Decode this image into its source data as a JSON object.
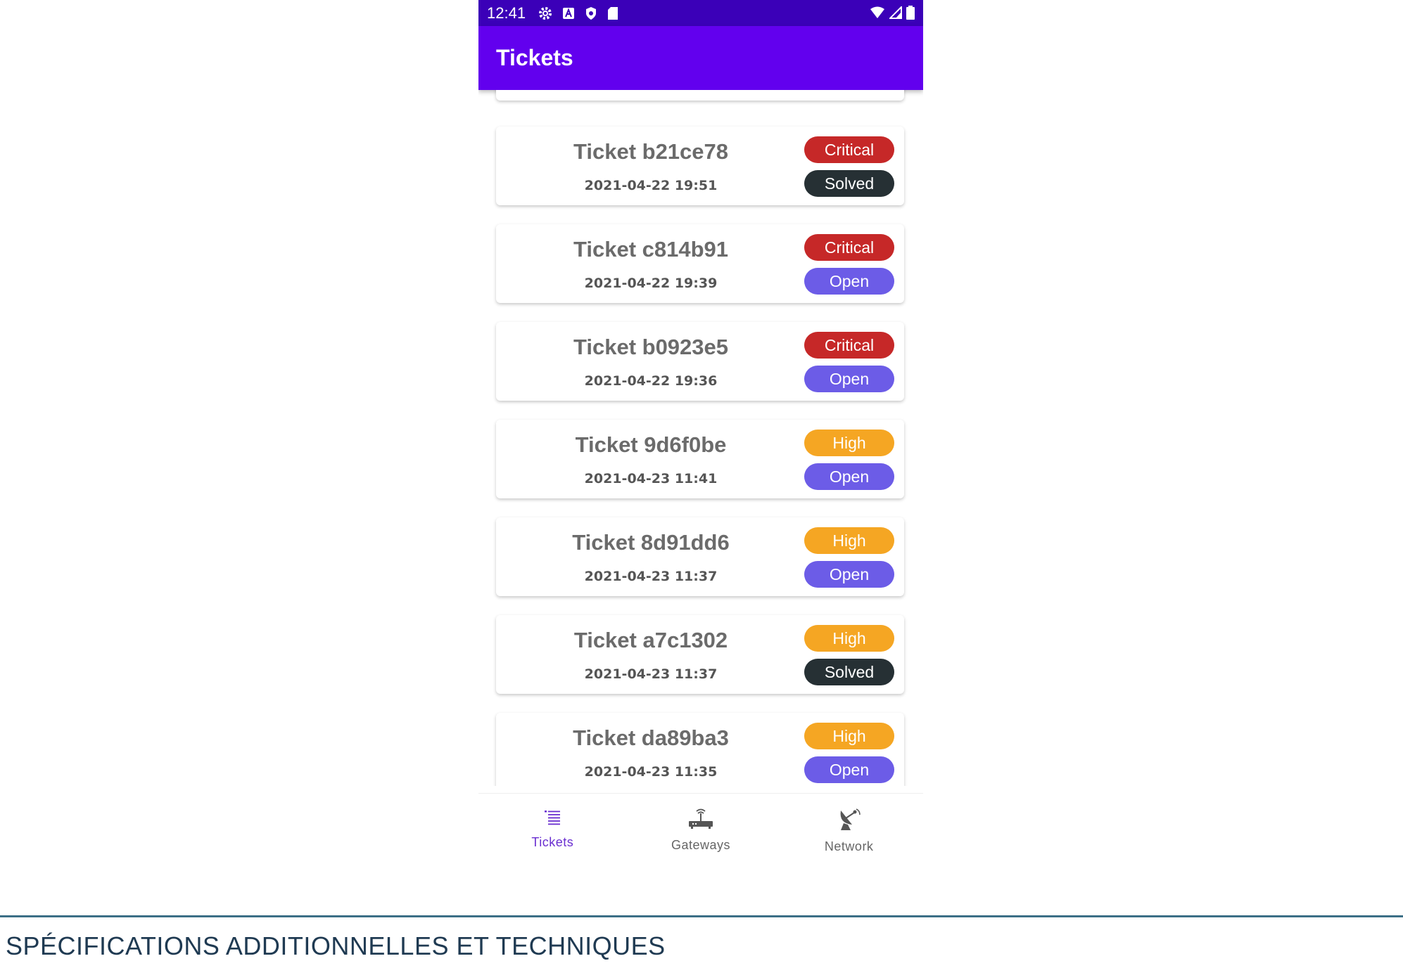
{
  "status_bar": {
    "time": "12:41",
    "icons": [
      "gear-icon",
      "a-badge-icon",
      "shield-icon",
      "sd-card-icon"
    ],
    "right_icons": [
      "wifi-icon",
      "signal-icon",
      "battery-icon"
    ]
  },
  "app_bar": {
    "title": "Tickets"
  },
  "colors": {
    "status_bar": "#3b00b8",
    "app_bar": "#6200ee",
    "critical": "#c62828",
    "high": "#f5a623",
    "solved": "#263034",
    "open": "#6c5ce7",
    "nav_active": "#6a2fd0"
  },
  "tickets": [
    {
      "title": "Ticket b21ce78",
      "date": "2021-04-22 19:51",
      "priority": "Critical",
      "status": "Solved"
    },
    {
      "title": "Ticket c814b91",
      "date": "2021-04-22 19:39",
      "priority": "Critical",
      "status": "Open"
    },
    {
      "title": "Ticket b0923e5",
      "date": "2021-04-22 19:36",
      "priority": "Critical",
      "status": "Open"
    },
    {
      "title": "Ticket 9d6f0be",
      "date": "2021-04-23 11:41",
      "priority": "High",
      "status": "Open"
    },
    {
      "title": "Ticket 8d91dd6",
      "date": "2021-04-23 11:37",
      "priority": "High",
      "status": "Open"
    },
    {
      "title": "Ticket a7c1302",
      "date": "2021-04-23 11:37",
      "priority": "High",
      "status": "Solved"
    },
    {
      "title": "Ticket da89ba3",
      "date": "2021-04-23 11:35",
      "priority": "High",
      "status": "Open"
    }
  ],
  "bottom_nav": [
    {
      "label": "Tickets",
      "icon": "list-icon",
      "active": true
    },
    {
      "label": "Gateways",
      "icon": "router-icon",
      "active": false
    },
    {
      "label": "Network",
      "icon": "satellite-dish-icon",
      "active": false
    }
  ],
  "footer": {
    "text": "SPÉCIFICATIONS ADDITIONNELLES ET TECHNIQUES"
  }
}
